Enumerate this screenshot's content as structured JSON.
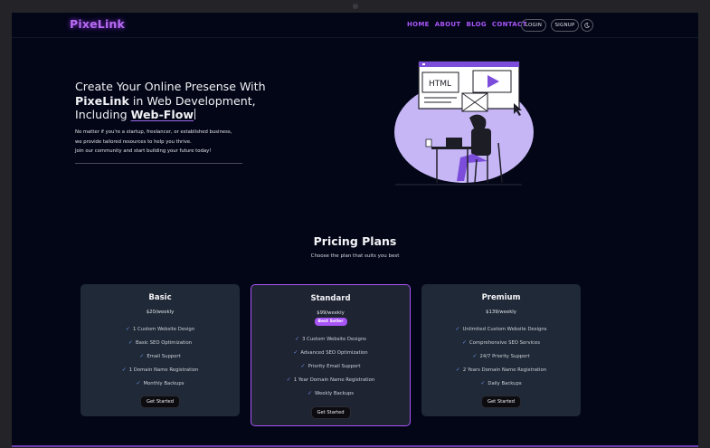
{
  "brand": "PixeLink",
  "nav": {
    "links": [
      "HOME",
      "ABOUT",
      "BLOG",
      "CONTACT"
    ],
    "login": "LOGIN",
    "signup": "SIGNUP",
    "theme_icon": "moon-icon"
  },
  "hero": {
    "line1": "Create Your Online Presense With",
    "brand": "PixeLink",
    "line2_rest": " in Web Development,",
    "line3_prefix": "Including ",
    "typed_word": "Web-Flow",
    "desc1": "No matter if you're a startup, freelancer, or established business,",
    "desc2": "we provide tailored resources to help you thrive.",
    "desc3": "Join our community and start building your future today!",
    "illustration_text": "HTML"
  },
  "pricing": {
    "title": "Pricing Plans",
    "subtitle": "Choose the plan that suits you best",
    "plans": [
      {
        "name": "Basic",
        "price": "$20/weekly",
        "features": [
          "1 Custom Website Design",
          "Basic SEO Optimization",
          "Email Support",
          "1 Domain Name Registration",
          "Monthly Backups"
        ],
        "button": "Get Started"
      },
      {
        "name": "Standard",
        "price": "$99/weekly",
        "badge": "Best Seller",
        "features": [
          "3 Custom Website Designs",
          "Advanced SEO Optimization",
          "Priority Email Support",
          "1 Year Domain Name Registration",
          "Weekly Backups"
        ],
        "button": "Get Started"
      },
      {
        "name": "Premium",
        "price": "$139/weekly",
        "features": [
          "Unlimited Custom Website Designs",
          "Comprehensive SEO Services",
          "24/7 Priority Support",
          "2 Years Domain Name Registration",
          "Daily Backups"
        ],
        "button": "Get Started"
      }
    ]
  },
  "colors": {
    "accent": "#a855f7",
    "card": "#1f2937",
    "background": "#020617",
    "check": "#6d8fe8"
  }
}
